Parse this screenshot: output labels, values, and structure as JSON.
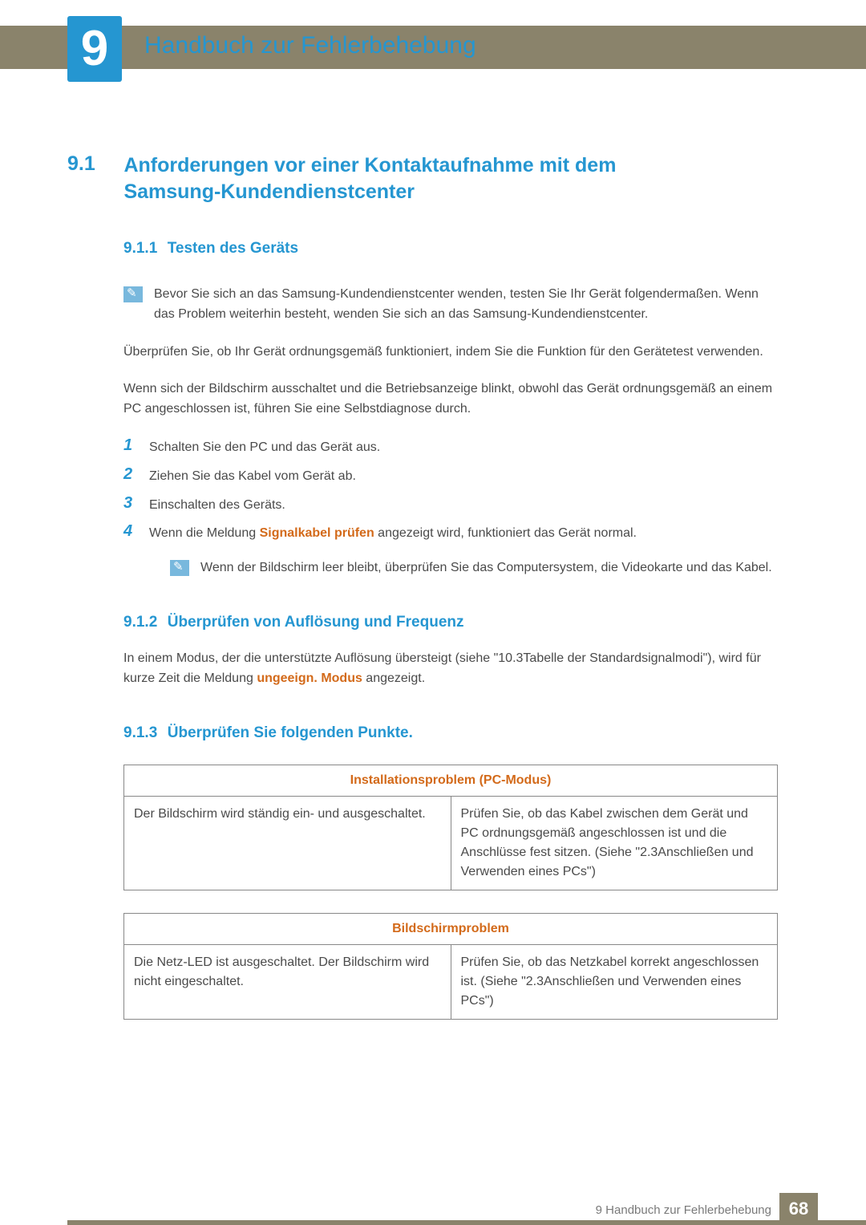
{
  "chapter": {
    "number": "9",
    "title": "Handbuch zur Fehlerbehebung"
  },
  "section": {
    "number": "9.1",
    "title": "Anforderungen vor einer Kontaktaufnahme mit dem Samsung-Kundendienstcenter"
  },
  "sub1": {
    "number": "9.1.1",
    "title": "Testen des Geräts",
    "note1_l1": "Bevor Sie sich an das Samsung-Kundendienstcenter wenden, testen Sie Ihr Gerät folgendermaßen.",
    "note1_l2": "Wenn das Problem weiterhin besteht, wenden Sie sich an das Samsung-Kundendienstcenter.",
    "para1": "Überprüfen Sie, ob Ihr Gerät ordnungsgemäß funktioniert, indem Sie die Funktion für den Gerätetest verwenden.",
    "para2": "Wenn sich der Bildschirm ausschaltet und die Betriebsanzeige blinkt, obwohl das Gerät ordnungsgemäß an einem PC angeschlossen ist, führen Sie eine Selbstdiagnose durch.",
    "steps": [
      "Schalten Sie den PC und das Gerät aus.",
      "Ziehen Sie das Kabel vom Gerät ab.",
      "Einschalten des Geräts."
    ],
    "step4_pre": "Wenn die Meldung ",
    "step4_hl": "Signalkabel prüfen",
    "step4_post": " angezeigt wird, funktioniert das Gerät normal.",
    "note2": "Wenn der Bildschirm leer bleibt, überprüfen Sie das Computersystem, die Videokarte und das Kabel."
  },
  "sub2": {
    "number": "9.1.2",
    "title": "Überprüfen von Auflösung und Frequenz",
    "para_pre": "In einem Modus, der die unterstützte Auflösung übersteigt (siehe \"10.3Tabelle der Standardsignalmodi\"), wird für kurze Zeit die Meldung ",
    "para_hl": "ungeeign. Modus",
    "para_post": " angezeigt."
  },
  "sub3": {
    "number": "9.1.3",
    "title": "Überprüfen Sie folgenden Punkte.",
    "table1": {
      "header": "Installationsproblem (PC-Modus)",
      "left": "Der Bildschirm wird ständig ein- und ausgeschaltet.",
      "right": "Prüfen Sie, ob das Kabel zwischen dem Gerät und PC ordnungsgemäß angeschlossen ist und die Anschlüsse fest sitzen. (Siehe \"2.3Anschließen und Verwenden eines PCs\")"
    },
    "table2": {
      "header": "Bildschirmproblem",
      "left": "Die Netz-LED ist ausgeschaltet. Der Bildschirm wird nicht eingeschaltet.",
      "right": "Prüfen Sie, ob das Netzkabel korrekt angeschlossen ist. (Siehe \"2.3Anschließen und Verwenden eines PCs\")"
    }
  },
  "footer": {
    "text": "9 Handbuch zur Fehlerbehebung",
    "page": "68"
  },
  "nums": {
    "n1": "1",
    "n2": "2",
    "n3": "3",
    "n4": "4"
  }
}
